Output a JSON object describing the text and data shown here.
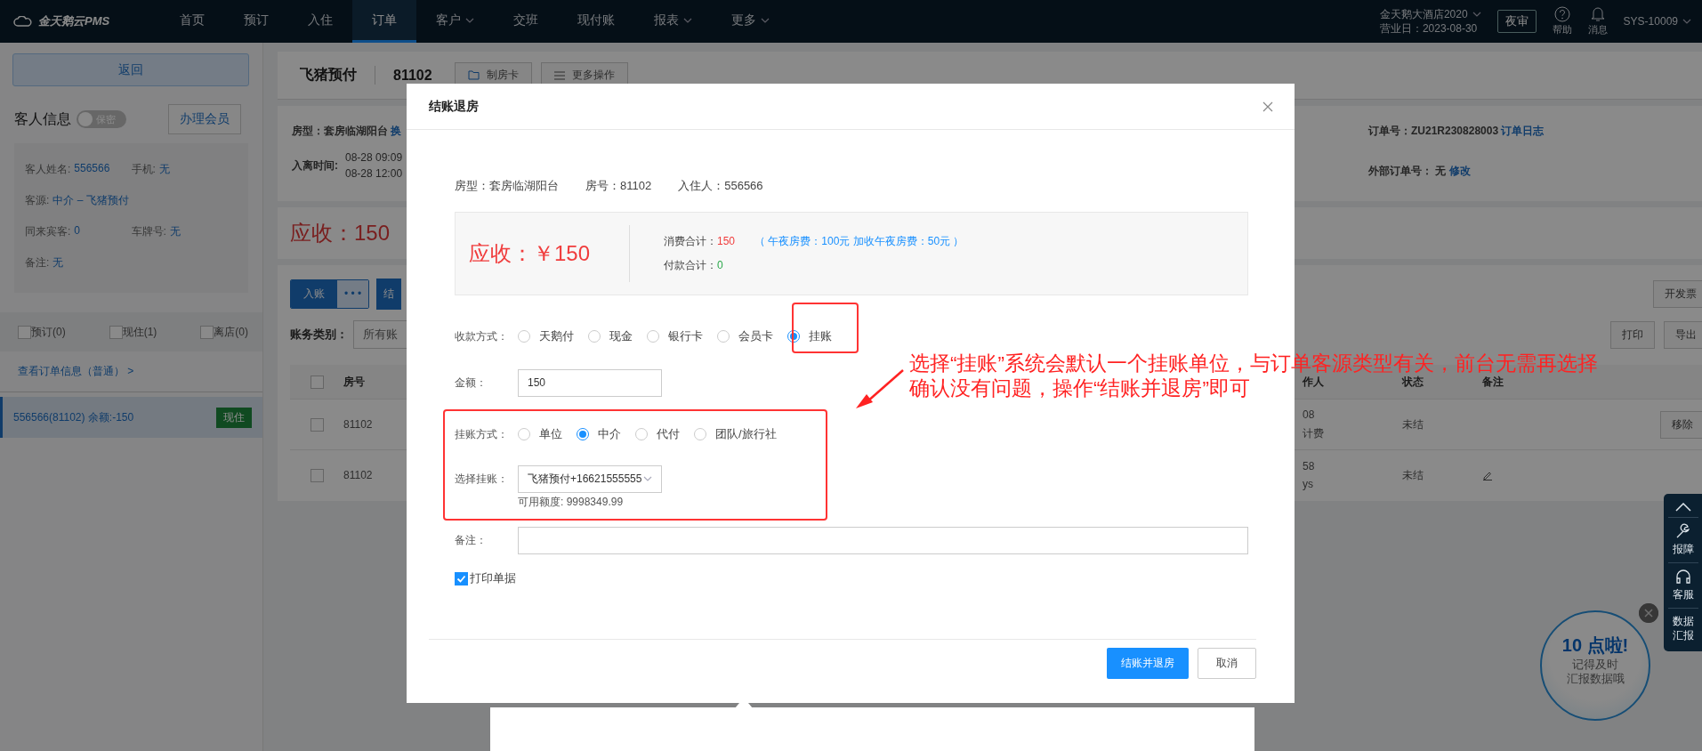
{
  "nav": {
    "logo": "金天鹅云PMS",
    "items": [
      {
        "label": "首页",
        "selected": false,
        "has_menu": false
      },
      {
        "label": "预订",
        "selected": false,
        "has_menu": false
      },
      {
        "label": "入住",
        "selected": false,
        "has_menu": false
      },
      {
        "label": "订单",
        "selected": true,
        "has_menu": false
      },
      {
        "label": "客户",
        "selected": false,
        "has_menu": true
      },
      {
        "label": "交班",
        "selected": false,
        "has_menu": false
      },
      {
        "label": "现付账",
        "selected": false,
        "has_menu": false
      },
      {
        "label": "报表",
        "selected": false,
        "has_menu": true
      },
      {
        "label": "更多",
        "selected": false,
        "has_menu": true
      }
    ],
    "hotel": "金天鹅大酒店2020",
    "business_day": "营业日：2023-08-30",
    "night_audit": "夜审",
    "help": "帮助",
    "messages": "消息",
    "user": "SYS-10009"
  },
  "left_panel": {
    "back": "返回",
    "guest_info_title": "客人信息",
    "privacy_toggle": {
      "label": "保密",
      "on": false
    },
    "member_button": "办理会员",
    "guest_rows": [
      [
        {
          "label": "客人姓名:",
          "value": "556566"
        },
        {
          "label": "手机:",
          "value": "无"
        }
      ],
      [
        {
          "label": "客源:",
          "value": "中介  – 飞猪预付"
        }
      ],
      [
        {
          "label": "同来宾客:",
          "value": "0"
        },
        {
          "label": "车牌号:",
          "value": "无"
        }
      ],
      [
        {
          "label": "备注:",
          "value": "无"
        }
      ]
    ],
    "filters": [
      {
        "label": "预订(0)",
        "checked": false
      },
      {
        "label": "现住(1)",
        "checked": false
      },
      {
        "label": "离店(0)",
        "checked": false
      }
    ],
    "order_link": "查看订单信息（普通） >",
    "rooms": [
      {
        "label": "556566(81102)  余额:-150",
        "badge": "现住",
        "selected": true
      }
    ]
  },
  "order_header": {
    "source": "飞猪预付",
    "room_no": "81102",
    "buttons": [
      {
        "label": "制房卡"
      },
      {
        "label": "更多操作"
      }
    ]
  },
  "order_info": {
    "room_type": "房型：套房临湖阳台",
    "change_room": "换",
    "stay_label": "入离时间:",
    "stay_times": [
      "08-28 09:09",
      "08-28 12:00"
    ],
    "order_no": "订单号：ZU21R230828003",
    "order_log": "订单日志",
    "external_no": "外部订单号：  无",
    "external_edit": "修改"
  },
  "receivable": "应收：150",
  "billing": {
    "post_button": "入账",
    "more_button": "• • •",
    "partial_button": "结",
    "invoice": "开发票",
    "category_label": "账务类别：",
    "category_value": "所有账",
    "print": "打印",
    "export": "导出",
    "select_all_checked": false,
    "columns": [
      "房号",
      "作人",
      "状态",
      "备注"
    ],
    "rows": [
      {
        "checked": false,
        "room": "81102",
        "operator": [
          "08",
          "计费"
        ],
        "status": "未结",
        "action": "移除"
      },
      {
        "checked": false,
        "room": "81102",
        "operator": [
          "58",
          "ys"
        ],
        "status": "未结",
        "note_icon": true
      }
    ]
  },
  "dialog": {
    "title": "结账退房",
    "room_type": "房型：套房临湖阳台",
    "room_no": "房号：81102",
    "guest": "入住人：556566",
    "due": "应收：￥150",
    "consumption_label": "消费合计：",
    "consumption": "150",
    "consumption_detail": "（ 午夜房费：100元  加收午夜房费：50元 ）",
    "payment_label": "付款合计：",
    "payment": "0",
    "payment_method_label": "收款方式：",
    "payment_methods": [
      {
        "label": "天鹅付",
        "selected": false
      },
      {
        "label": "现金",
        "selected": false
      },
      {
        "label": "银行卡",
        "selected": false
      },
      {
        "label": "会员卡",
        "selected": false
      },
      {
        "label": "挂账",
        "selected": true
      }
    ],
    "amount_label": "金额：",
    "amount": "150",
    "credit_type_label": "挂账方式：",
    "credit_types": [
      {
        "label": "单位",
        "selected": false
      },
      {
        "label": "中介",
        "selected": true
      },
      {
        "label": "代付",
        "selected": false
      },
      {
        "label": "团队/旅行社",
        "selected": false
      }
    ],
    "credit_account_label": "选择挂账：",
    "credit_account": "飞猪预付+16621555555",
    "available_credit": "可用额度: 9998349.99",
    "remark_label": "备注：",
    "print_receipt": {
      "label": "打印单据",
      "checked": true
    },
    "confirm": "结账并退房",
    "cancel": "取消"
  },
  "annotation": {
    "lines": [
      "选择“挂账”系统会默认一个挂账单位，与订单客源类型有关，前台无需再选择",
      "确认没有问题，操作“结账并退房”即可"
    ]
  },
  "side_toolbar": [
    {
      "kind": "top"
    },
    {
      "kind": "wrench",
      "label": "报障"
    },
    {
      "kind": "headset",
      "label": "客服"
    },
    {
      "kind": "text",
      "label": "数据汇报"
    }
  ],
  "reminder_bubble": {
    "title": "10 点啦!",
    "lines": [
      "记得及时",
      "汇报数据哦"
    ]
  }
}
